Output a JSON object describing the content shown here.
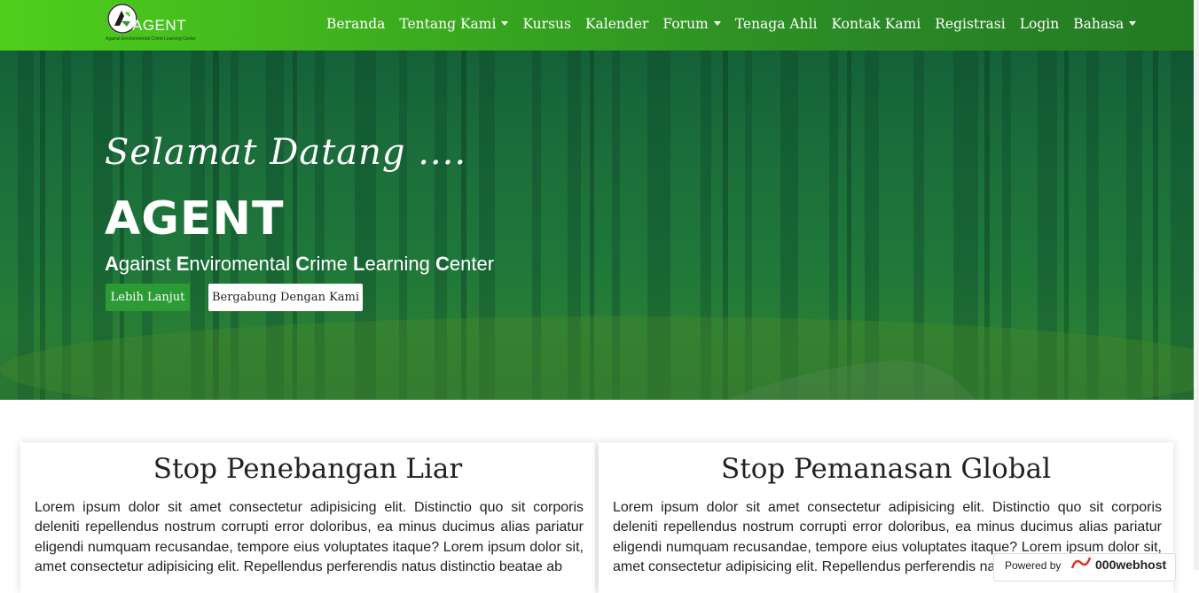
{
  "brand": {
    "name": "AGENT",
    "tagline": "Against Environmental Crime Learning Center"
  },
  "nav": {
    "items": [
      {
        "label": "Beranda",
        "dropdown": false
      },
      {
        "label": "Tentang Kami",
        "dropdown": true
      },
      {
        "label": "Kursus",
        "dropdown": false
      },
      {
        "label": "Kalender",
        "dropdown": false
      },
      {
        "label": "Forum",
        "dropdown": true
      },
      {
        "label": "Tenaga Ahli",
        "dropdown": false
      },
      {
        "label": "Kontak Kami",
        "dropdown": false
      },
      {
        "label": "Registrasi",
        "dropdown": false
      },
      {
        "label": "Login",
        "dropdown": false
      },
      {
        "label": "Bahasa",
        "dropdown": true
      }
    ]
  },
  "hero": {
    "greeting": "Selamat Datang ....",
    "title": "AGENT",
    "subtitle_parts": [
      {
        "initial": "A",
        "rest": "gainst "
      },
      {
        "initial": "E",
        "rest": "nviromental "
      },
      {
        "initial": "C",
        "rest": "rime "
      },
      {
        "initial": "L",
        "rest": "earning "
      },
      {
        "initial": "C",
        "rest": "enter"
      }
    ],
    "primary_button": "Lebih Lanjut",
    "secondary_button": "Bergabung Dengan Kami"
  },
  "cards": [
    {
      "title": "Stop Penebangan Liar",
      "body": "Lorem ipsum dolor sit amet consectetur adipisicing elit. Distinctio quo sit corporis deleniti repellendus nostrum corrupti error doloribus, ea minus ducimus alias pariatur eligendi numquam recusandae, tempore eius voluptates itaque? Lorem ipsum dolor sit, amet consectetur adipisicing elit. Repellendus perferendis natus distinctio beatae ab"
    },
    {
      "title": "Stop Pemanasan Global",
      "body": "Lorem ipsum dolor sit amet consectetur adipisicing elit. Distinctio quo sit corporis deleniti repellendus nostrum corrupti error doloribus, ea minus ducimus alias pariatur eligendi numquam recusandae, tempore eius voluptates itaque? Lorem ipsum dolor sit, amet consectetur adipisicing elit. Repellendus perferendis natus distinctio beatae ab"
    }
  ],
  "powered_by": {
    "text": "Powered by",
    "brand": "000webhost"
  },
  "colors": {
    "nav_start": "#4fcf1c",
    "nav_end": "#237a23",
    "primary_button": "#2d9b35"
  }
}
